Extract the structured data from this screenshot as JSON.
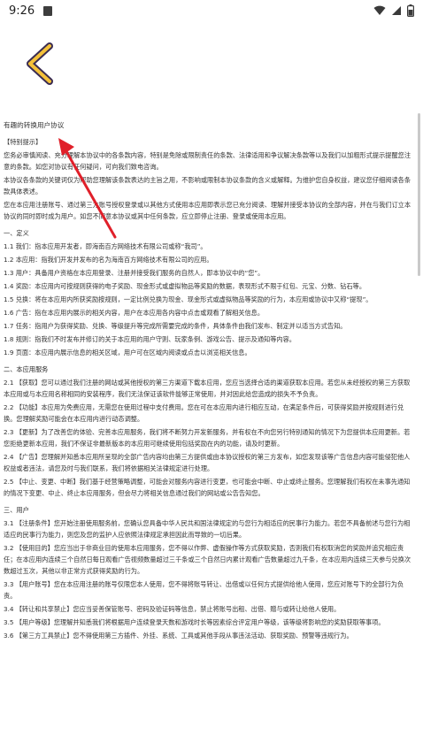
{
  "status_bar": {
    "time": "9:26"
  },
  "document": {
    "title": "有趣的转换用户协议",
    "special_notice_heading": "【特别提示】",
    "intro": [
      "您务必审慎阅读、充分理解本协议中的各条款内容，特别是免除或限制责任的条款、法律适用和争议解决条款等以及我们以加粗形式提示提醒您注意的条款。如您对协议有任何疑问，可向我们致电咨询。",
      "本协议各条款的关键词仅为帮助您理解该条款表达的主旨之用，不影响或限制本协议条款的含义或解释。为维护您自身权益，建议您仔细阅读各条款具体表述。",
      "您在本应用注册账号、通过第三方账号授权登录或以其他方式使用本应用即表示您已充分阅读、理解并接受本协议的全部内容，并在与我们订立本协议的同时即时成为用户。如您不同意本协议或其中任何条款，应立即停止注册、登录或使用本应用。"
    ],
    "section1_heading": "一、定义",
    "definitions": [
      "1.1 我们：指本应用开发者，即海南百方网络技术有限公司或称“我司”。",
      "1.2 本应用：指我们开发并发布的名为海南百方网络技术有限公司的应用。",
      "1.3 用户：具备用户资格在本应用登录、注册并接受我们服务的自然人，即本协议中的“您”。",
      "1.4 奖励：本应用内可按规则获得的电子奖励、现金形式或虚拟物品等奖励的数据，表现形式不限于红包、元宝、分数、钻石等。",
      "1.5 兑换：将在本应用内所获奖励按规则，一定比例兑换为现金、现金形式或虚拟物品等奖励的行为，本应用或协议中又称“提现”。",
      "1.6 广告：指在本应用内展示的相关内容，用户在本应用各内容中点击或观看了解相关信息。",
      "1.7 任务：指用户为获得奖励、兑换、等级提升等完成所需要完成的条件，具体条件由我们发布、制定并以适当方式告知。",
      "1.8 规则：指我们不时发布并修订的关于本应用的用户守则、玩家条例、游戏公告、提示及通知等内容。",
      "1.9 页面：本应用内展示信息的相关区域，用户可在区域内阅读或点击以浏览相关信息。"
    ],
    "section2_heading": "二、本应用服务",
    "services": [
      "2.1 【获取】您可以通过我们注册的网站或其他授权的第三方渠道下载本应用，您应当选择合适的渠道获取本应用。若您从未经授权的第三方获取本应用或与本应用名称相同的安装程序，我们无法保证该软件能够正常使用，并对因此给您造成的损失不予负责。",
      "2.2 【功能】本应用为免费应用，无需您在使用过程中支付费用。您在可在本应用内进行相应互动，在满足条件后，可获得奖励并按规则进行兑换。您理解奖励可能会在本应用内进行动态调整。",
      "2.3 【更新】为了改善您的体验、完善本应用服务，我们将不断努力开发新服务，并有权在不向您另行特别通知的情况下为您提供本应用更新。若您拒绝更新本应用，我们不保证非最新版本的本应用可继续使用包括奖励在内的功能，请及时更新。",
      "2.4 【广告】您理解并知悉本应用所呈现的全部广告内容均由第三方提供或由本协议授权的第三方发布，如您发现该等广告信息内容可能侵犯他人权益或者违法，请您及时与我们联系，我们将依据相关法律规定进行处理。",
      "2.5 【中止、变更、中断】我们基于经营策略调整，可能会对服务内容进行变更，也可能会中断、中止或终止服务。您理解我们有权在未事先通知的情况下变更、中止、终止本应用服务，但会尽力将相关信息通过我们的网站或公告告知您。"
    ],
    "section3_heading": "三、用户",
    "users": [
      "3.1 【注册条件】您开始注册使用服务前，您确认您具备中华人民共和国法律规定的与您行为相适应的民事行为能力。若您不具备前述与您行为相适应的民事行为能力，则您及您的监护人应依照法律规定承担因此而导致的一切后果。",
      "3.2 【使用目的】您应当出于非商业目的使用本应用服务，您不得以作弊、虚假操作等方式获取奖励，否则我们有权取消您的奖励并追究相应责任；在本应用内连续三个自然日每日观看广告视频数量超过三千条或三个自然日内累计观看广告数量超过九千条，在本应用内连续三天参与兑换次数超过五次，其他以非正常方式获得奖励的行为。",
      "3.3 【用户账号】您在本应用注册的账号仅限您本人使用，您不得将账号转让、出借或以任何方式提供给他人使用，您应对账号下的全部行为负责。",
      "3.4 【转让和共享禁止】您应当妥善保管账号、密码及验证码等信息，禁止将账号出租、出借、赠与或转让给他人使用。",
      "3.5 【用户等级】您理解并知悉我们将根据用户连续登录天数和游戏时长等因素综合评定用户等级，该等级将影响您的奖励获取等事项。",
      "3.6 【第三方工具禁止】您不得使用第三方插件、外挂、系统、工具或其他手段从事违法活动、获取奖励、预警等违规行为。"
    ]
  }
}
